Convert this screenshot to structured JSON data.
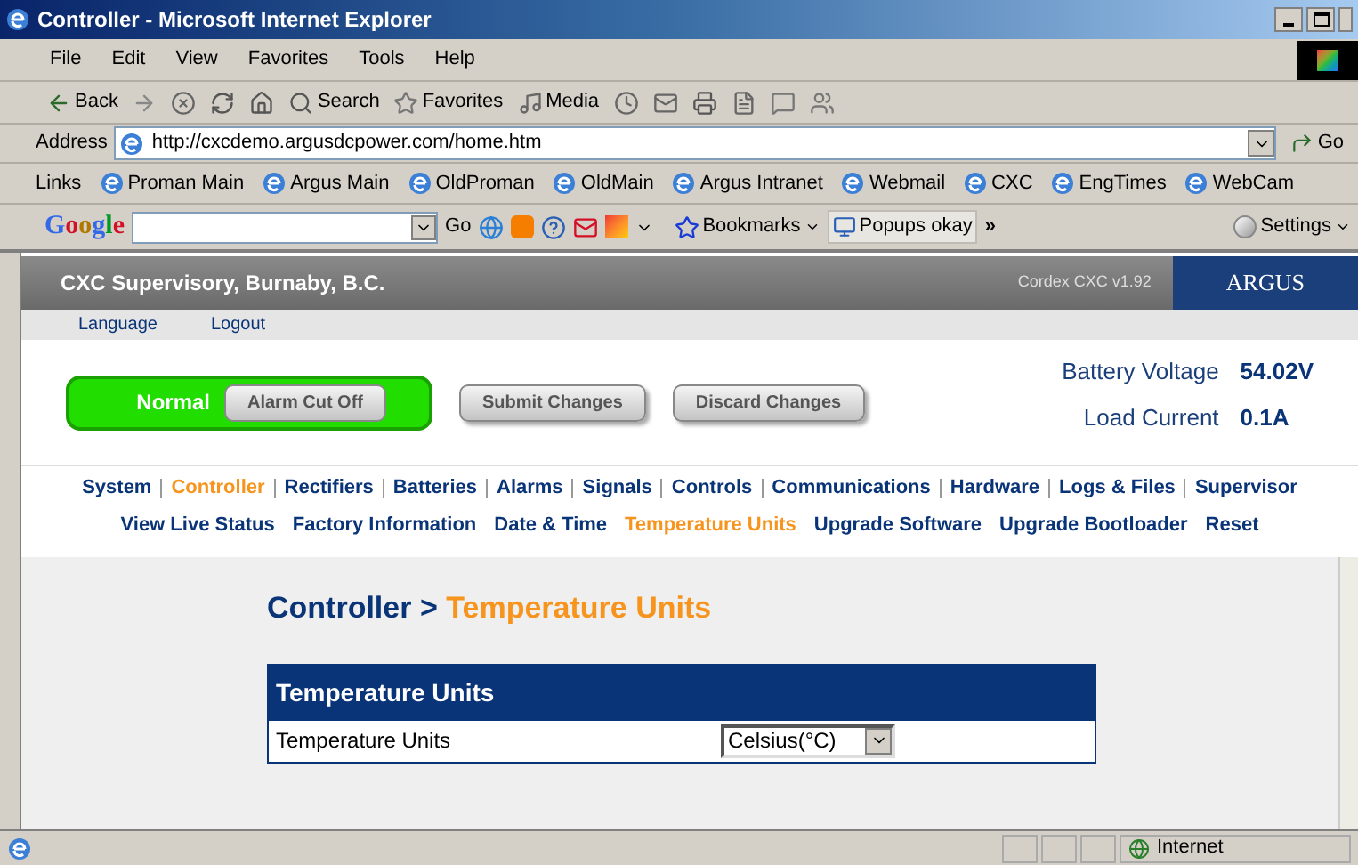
{
  "window": {
    "title": "Controller - Microsoft Internet Explorer"
  },
  "menu": [
    "File",
    "Edit",
    "View",
    "Favorites",
    "Tools",
    "Help"
  ],
  "toolbar": [
    {
      "kind": "back",
      "label": "Back"
    },
    {
      "kind": "forward"
    },
    {
      "kind": "stop"
    },
    {
      "kind": "refresh"
    },
    {
      "kind": "home"
    },
    {
      "kind": "search",
      "label": "Search"
    },
    {
      "kind": "favorites",
      "label": "Favorites"
    },
    {
      "kind": "media",
      "label": "Media"
    },
    {
      "kind": "history"
    },
    {
      "kind": "mail"
    },
    {
      "kind": "print"
    },
    {
      "kind": "edit"
    },
    {
      "kind": "discuss"
    },
    {
      "kind": "messenger"
    }
  ],
  "address": {
    "label": "Address",
    "value": "http://cxcdemo.argusdcpower.com/home.htm",
    "go": "Go"
  },
  "links": {
    "label": "Links",
    "items": [
      "Proman Main",
      "Argus Main",
      "OldProman",
      "OldMain",
      "Argus Intranet",
      "Webmail",
      "CXC",
      "EngTimes",
      "WebCam"
    ]
  },
  "google_toolbar": {
    "logo": "Google",
    "go": "Go",
    "bookmarks": "Bookmarks",
    "popups": "Popups okay",
    "more": "»",
    "settings": "Settings"
  },
  "page": {
    "site_title": "CXC Supervisory, Burnaby, B.C.",
    "version": "Cordex CXC v1.92",
    "brand": "ARGUS",
    "top_links": [
      "Language",
      "Logout"
    ],
    "status": "Normal",
    "alarm_button": "Alarm Cut Off",
    "actions": [
      "Submit Changes",
      "Discard Changes"
    ],
    "readings": [
      {
        "label": "Battery Voltage",
        "value": "54.02V"
      },
      {
        "label": "Load Current",
        "value": "0.1A"
      }
    ],
    "nav_primary": [
      {
        "label": "System",
        "selected": false
      },
      {
        "label": "Controller",
        "selected": true
      },
      {
        "label": "Rectifiers",
        "selected": false
      },
      {
        "label": "Batteries",
        "selected": false
      },
      {
        "label": "Alarms",
        "selected": false
      },
      {
        "label": "Signals",
        "selected": false
      },
      {
        "label": "Controls",
        "selected": false
      },
      {
        "label": "Communications",
        "selected": false
      },
      {
        "label": "Hardware",
        "selected": false
      },
      {
        "label": "Logs & Files",
        "selected": false
      },
      {
        "label": "Supervisor",
        "selected": false
      }
    ],
    "nav_secondary": [
      {
        "label": "View Live Status",
        "selected": false
      },
      {
        "label": "Factory Information",
        "selected": false
      },
      {
        "label": "Date & Time",
        "selected": false
      },
      {
        "label": "Temperature Units",
        "selected": true
      },
      {
        "label": "Upgrade Software",
        "selected": false
      },
      {
        "label": "Upgrade Bootloader",
        "selected": false
      },
      {
        "label": "Reset",
        "selected": false
      }
    ],
    "breadcrumb": {
      "parent": "Controller",
      "separator": ">",
      "current": "Temperature Units"
    },
    "panel": {
      "title": "Temperature Units",
      "rows": [
        {
          "label": "Temperature Units",
          "value": "Celsius(°C)"
        }
      ]
    }
  },
  "status_bar": {
    "zone": "Internet"
  }
}
